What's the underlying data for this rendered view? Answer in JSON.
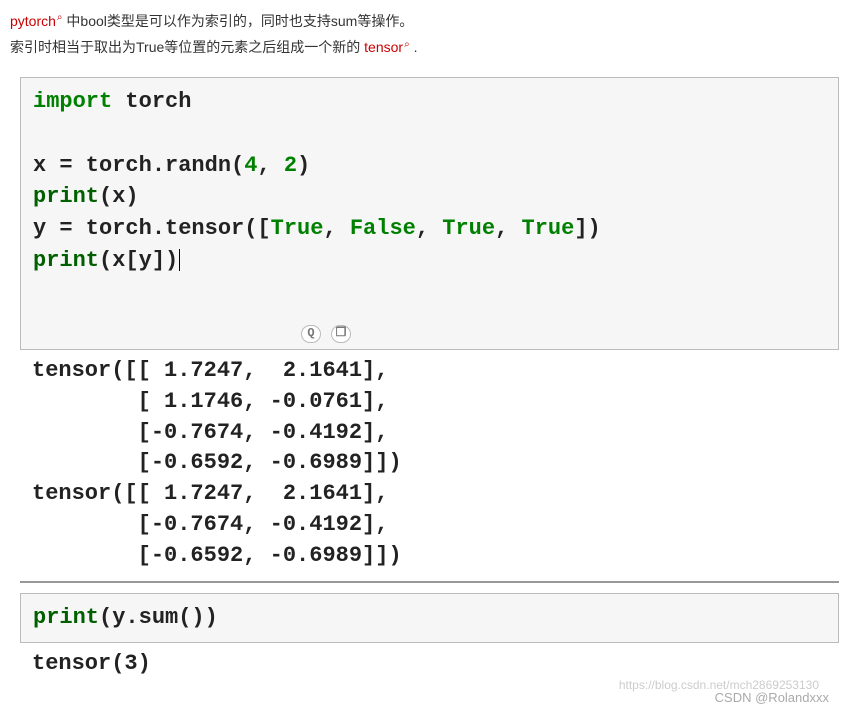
{
  "intro": {
    "link1": "pytorch",
    "line1_rest": " 中bool类型是可以作为索引的，同时也支持sum等操作。",
    "line2_pre": "索引时相当于取出为True等位置的元素之后组成一个新的 ",
    "link2": "tensor",
    "line2_post": " ."
  },
  "code1": {
    "l1_import": "import",
    "l1_mod": " torch",
    "blank": "",
    "l3": "x = torch.randn(",
    "l3_n1": "4",
    "l3_mid": ", ",
    "l3_n2": "2",
    "l3_end": ")",
    "l4_print": "print",
    "l4_arg": "(x)",
    "l5_pre": "y = torch.tensor([",
    "l5_true1": "True",
    "l5_c1": ", ",
    "l5_false": "False",
    "l5_c2": ", ",
    "l5_true2": "True",
    "l5_c3": ", ",
    "l5_true3": "True",
    "l5_end": "])",
    "l6_print": "print",
    "l6_arg": "(x[y])"
  },
  "output1": "tensor([[ 1.7247,  2.1641],\n        [ 1.1746, -0.0761],\n        [-0.7674, -0.4192],\n        [-0.6592, -0.6989]])\ntensor([[ 1.7247,  2.1641],\n        [-0.7674, -0.4192],\n        [-0.6592, -0.6989]])",
  "code2": {
    "print": "print",
    "arg": "(y.sum())"
  },
  "output2": "tensor(3)",
  "watermark_url": "https://blog.csdn.net/mch2869253130",
  "watermark_author": "CSDN @Rolandxxx"
}
